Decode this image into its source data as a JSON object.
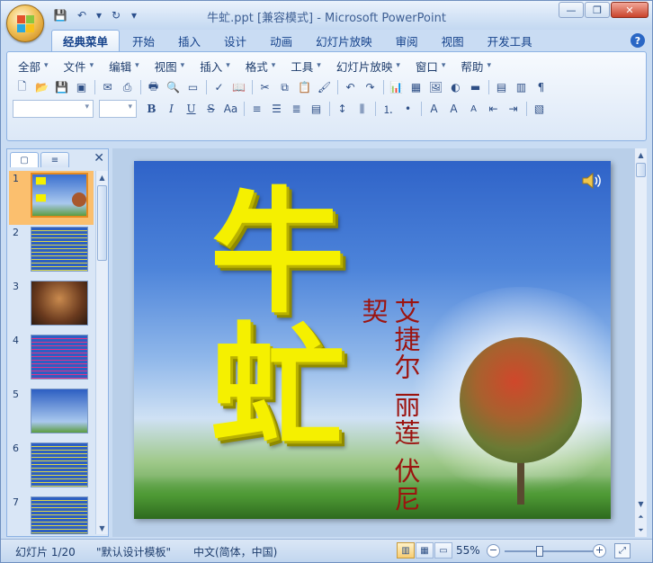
{
  "window": {
    "title": "牛虻.ppt [兼容模式] - Microsoft PowerPoint",
    "minimize": "—",
    "restore": "❐",
    "close": "✕"
  },
  "quick_access": {
    "save": "💾",
    "undo": "↶",
    "undo_arrow": "▾",
    "redo": "↻",
    "customize": "▾"
  },
  "ribbon_tabs": [
    {
      "label": "经典菜单",
      "active": true
    },
    {
      "label": "开始"
    },
    {
      "label": "插入"
    },
    {
      "label": "设计"
    },
    {
      "label": "动画"
    },
    {
      "label": "幻灯片放映"
    },
    {
      "label": "审阅"
    },
    {
      "label": "视图"
    },
    {
      "label": "开发工具"
    }
  ],
  "help_label": "?",
  "menu_bar": [
    "全部",
    "文件",
    "编辑",
    "视图",
    "插入",
    "格式",
    "工具",
    "幻灯片放映",
    "窗口",
    "帮助"
  ],
  "format_buttons": {
    "bold": "B",
    "italic": "I",
    "underline": "U",
    "strike": "S",
    "case": "Aa",
    "font_grow": "A",
    "font_shrink": "A"
  },
  "slide_pane": {
    "tab_slides": "▢",
    "tab_outline": "≡",
    "close": "✕",
    "thumbnails": [
      {
        "number": "1",
        "active": true
      },
      {
        "number": "2"
      },
      {
        "number": "3"
      },
      {
        "number": "4"
      },
      {
        "number": "5"
      },
      {
        "number": "6"
      },
      {
        "number": "7"
      }
    ]
  },
  "slide": {
    "title": "牛虻",
    "author": "艾捷尔 丽莲 伏尼契",
    "speaker_icon": "speaker-icon"
  },
  "status_bar": {
    "slide_info": "幻灯片 1/20",
    "template": "\"默认设计模板\"",
    "language": "中文(简体，中国)",
    "zoom": "55%",
    "zoom_fraction": 0.38
  },
  "colors": {
    "title_yellow": "#f5f000",
    "author_red": "#9c1410",
    "accent_blue": "#15428b",
    "active_thumb": "#fbbf6e"
  }
}
